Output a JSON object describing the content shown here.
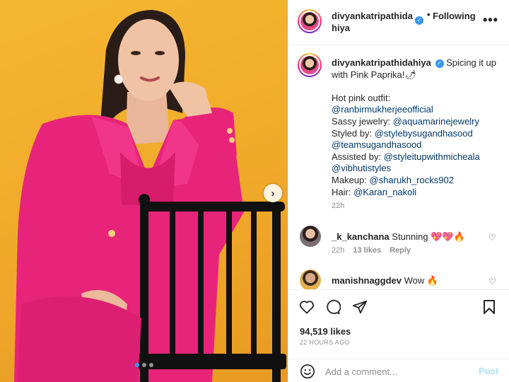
{
  "post": {
    "username": "divyankatripathidahiya",
    "username_header": "divyankatripathida hiya",
    "separator": "•",
    "follow_status": "Following",
    "more_icon": "more-horizontal-icon"
  },
  "caption": {
    "lead_text": "Spicing it up with Pink Paprika!🌶",
    "outfit_label": "Hot pink outfit:",
    "outfit_handle": "@ranbirmukherjeeofficial",
    "jewelry_label": "Sassy jewelry:",
    "jewelry_handle": "@aquamarinejewelry",
    "styled_label": "Styled by:",
    "styled_handle_1": "@stylebysugandhasood",
    "styled_handle_2": "@teamsugandhasood",
    "assisted_label": "Assisted by:",
    "assisted_handle_1": "@styleitupwithmicheala",
    "assisted_handle_2": "@vibhutistyles",
    "makeup_label": "Makeup:",
    "makeup_handle": "@sharukh_rocks902",
    "hair_label": "Hair:",
    "hair_handle": "@Karan_nakoli",
    "time": "22h"
  },
  "comments": [
    {
      "username": "_k_kanchana",
      "text": "Stunning 💖💖🔥",
      "time": "22h",
      "likes": "13 likes",
      "reply": "Reply"
    },
    {
      "username": "manishnaggdev",
      "text": "Wow 🔥"
    }
  ],
  "actions": {
    "likes": "94,519 likes",
    "posted": "22 HOURS AGO",
    "icons": [
      "heart-icon",
      "comment-icon",
      "share-icon",
      "bookmark-icon"
    ]
  },
  "add_comment": {
    "placeholder": "Add a comment...",
    "post_label": "Post",
    "emoji_icon": "smiley-icon"
  },
  "carousel": {
    "next_glyph": "›",
    "slides": 3,
    "active_slide": 1
  },
  "colors": {
    "background_photo": "#f0a92a",
    "outfit": "#e8247a",
    "link": "#00376b",
    "verified": "#3897f0",
    "post_disabled": "#b2dffc"
  }
}
